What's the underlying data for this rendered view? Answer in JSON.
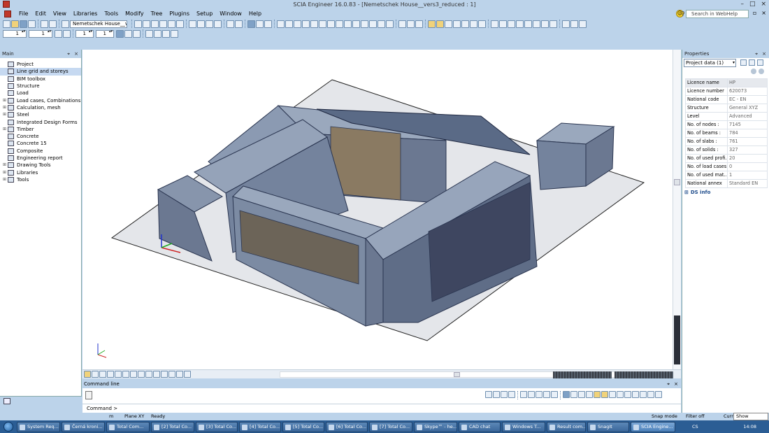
{
  "window": {
    "title": "SCIA Engineer 16.0.83 - [Nemetschek House__vers3_reduced : 1]"
  },
  "menu": {
    "items": [
      "File",
      "Edit",
      "View",
      "Libraries",
      "Tools",
      "Modify",
      "Tree",
      "Plugins",
      "Setup",
      "Window",
      "Help"
    ],
    "search_placeholder": "Search in WebHelp"
  },
  "toolbar": {
    "spin1": "1",
    "spin2": "1",
    "project_combo": "Nemetschek House__vers",
    "spin3": "1",
    "spin4": "1"
  },
  "main_pane": {
    "title": "Main",
    "items": [
      {
        "label": "Project",
        "expandable": false,
        "selected": false
      },
      {
        "label": "Line grid and storeys",
        "expandable": false,
        "selected": true
      },
      {
        "label": "BIM toolbox",
        "expandable": false,
        "selected": false
      },
      {
        "label": "Structure",
        "expandable": false,
        "selected": false
      },
      {
        "label": "Load",
        "expandable": false,
        "selected": false
      },
      {
        "label": "Load cases, Combinations",
        "expandable": true,
        "selected": false
      },
      {
        "label": "Calculation, mesh",
        "expandable": true,
        "selected": false
      },
      {
        "label": "Steel",
        "expandable": true,
        "selected": false
      },
      {
        "label": "Integrated Design Forms",
        "expandable": false,
        "selected": false
      },
      {
        "label": "Timber",
        "expandable": true,
        "selected": false
      },
      {
        "label": "Concrete",
        "expandable": false,
        "selected": false
      },
      {
        "label": "Concrete 15",
        "expandable": false,
        "selected": false
      },
      {
        "label": "Composite",
        "expandable": false,
        "selected": false
      },
      {
        "label": "Engineering report",
        "expandable": false,
        "selected": false
      },
      {
        "label": "Drawing Tools",
        "expandable": true,
        "selected": false
      },
      {
        "label": "Libraries",
        "expandable": true,
        "selected": false
      },
      {
        "label": "Tools",
        "expandable": true,
        "selected": false
      }
    ]
  },
  "properties_pane": {
    "title": "Properties",
    "selector": "Project data (1)",
    "rows": [
      {
        "key": "Licence name",
        "value": "HP"
      },
      {
        "key": "Licence number",
        "value": "620073"
      },
      {
        "key": "National code",
        "value": "EC - EN"
      },
      {
        "key": "Structure",
        "value": "General XYZ"
      },
      {
        "key": "Level",
        "value": "Advanced"
      },
      {
        "key": "No. of nodes :",
        "value": "7145"
      },
      {
        "key": "No. of beams :",
        "value": "784"
      },
      {
        "key": "No. of slabs :",
        "value": "761"
      },
      {
        "key": "No. of solids :",
        "value": "327"
      },
      {
        "key": "No. of used profi...",
        "value": "20"
      },
      {
        "key": "No. of load cases :",
        "value": "0"
      },
      {
        "key": "No. of used mat...",
        "value": "1"
      },
      {
        "key": "National annex",
        "value": "Standard EN"
      }
    ],
    "ds_info": "DS info"
  },
  "command": {
    "title": "Command line",
    "prompt": "Command >"
  },
  "status": {
    "unit": "m",
    "plane": "Plane XY",
    "state": "Ready",
    "snap": "Snap mode",
    "filter": "Filter off",
    "curr": "Curre",
    "show_desktop": "Show desktop"
  },
  "taskbar": {
    "tasks": [
      {
        "label": "System Req...",
        "active": false
      },
      {
        "label": "Černá kroni...",
        "active": false
      },
      {
        "label": "Total Com...",
        "active": false
      },
      {
        "label": "[2] Total Co...",
        "active": false
      },
      {
        "label": "[3] Total Co...",
        "active": false
      },
      {
        "label": "[4] Total Co...",
        "active": false
      },
      {
        "label": "[5] Total Co...",
        "active": false
      },
      {
        "label": "[6] Total Co...",
        "active": false
      },
      {
        "label": "[7] Total Co...",
        "active": false
      },
      {
        "label": "Skype™ - he...",
        "active": false
      },
      {
        "label": "CAD chat",
        "active": false
      },
      {
        "label": "Windows T...",
        "active": false
      },
      {
        "label": "Result com...",
        "active": false
      },
      {
        "label": "SnagIt",
        "active": false
      },
      {
        "label": "SCIA Engine...",
        "active": true
      }
    ],
    "lang": "CS",
    "clock": "14:08"
  },
  "colors": {
    "chrome": "#bcd3ea",
    "taskbar": "#2b5d94",
    "selection": "#c6d9f1",
    "model_stroke": "#2a3550",
    "model_fill": "#7d8ea8"
  }
}
